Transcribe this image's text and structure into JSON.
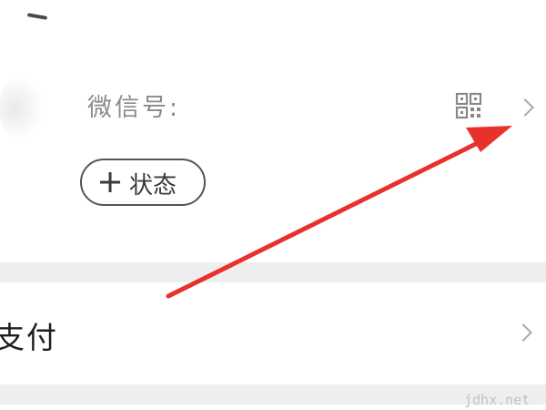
{
  "profile": {
    "wechat_id_label": "微信号:",
    "status_button_label": "状态",
    "status_button_icon": "plus-icon",
    "qr_icon": "qr-code-icon",
    "chevron_icon": "chevron-right-icon"
  },
  "menu": {
    "pay_label": "支付",
    "chevron_icon": "chevron-right-icon"
  },
  "annotation": {
    "arrow_color": "#e8312a",
    "points_to": "chevron-right-icon"
  },
  "watermark": {
    "text": "jdhx.net"
  },
  "colors": {
    "background": "#ffffff",
    "divider": "#eeeeee",
    "label_gray": "#8a8a8a",
    "text_dark": "#1f1f1f"
  }
}
